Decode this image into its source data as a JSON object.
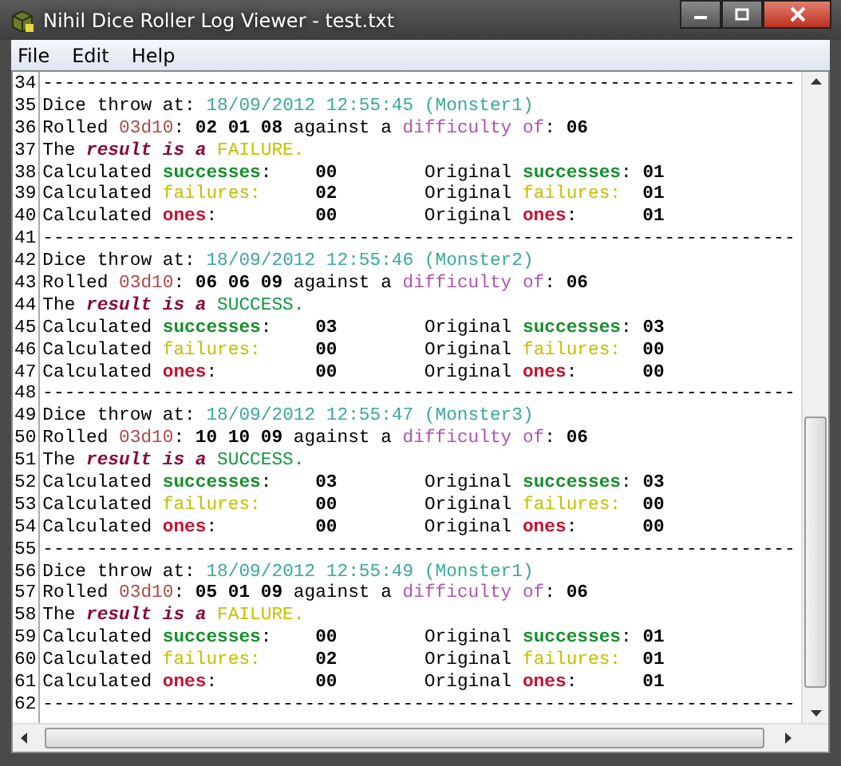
{
  "window": {
    "title": "Nihil Dice Roller Log Viewer - test.txt"
  },
  "menu": [
    {
      "label": "File"
    },
    {
      "label": "Edit"
    },
    {
      "label": "Help"
    }
  ],
  "lines": [
    {
      "number": "34",
      "segments": [
        {
          "kind": "plain",
          "text": "---------------------------------------------------------------------"
        }
      ]
    },
    {
      "number": "35",
      "segments": [
        {
          "kind": "plain",
          "text": "Dice throw at: "
        },
        {
          "kind": "date",
          "text": "18/09/2012 12:55:45 (Monster1)"
        }
      ]
    },
    {
      "number": "36",
      "segments": [
        {
          "kind": "plain",
          "text": "Rolled "
        },
        {
          "kind": "dice",
          "text": "03d10"
        },
        {
          "kind": "plain",
          "text": ": "
        },
        {
          "kind": "value",
          "text": "02 01 08"
        },
        {
          "kind": "plain",
          "text": " against a "
        },
        {
          "kind": "difficulty",
          "text": "difficulty of"
        },
        {
          "kind": "plain",
          "text": ": "
        },
        {
          "kind": "value",
          "text": "06"
        }
      ]
    },
    {
      "number": "37",
      "segments": [
        {
          "kind": "plain",
          "text": "The "
        },
        {
          "kind": "emphasis",
          "text": "result is a "
        },
        {
          "kind": "failure_result",
          "text": "FAILURE."
        }
      ]
    },
    {
      "number": "38",
      "segments": [
        {
          "kind": "plain",
          "text": "Calculated "
        },
        {
          "kind": "successes",
          "text": "successes"
        },
        {
          "kind": "plain",
          "text": ":    "
        },
        {
          "kind": "value",
          "text": "00"
        },
        {
          "kind": "plain",
          "text": "        Original "
        },
        {
          "kind": "successes",
          "text": "successes"
        },
        {
          "kind": "plain",
          "text": ": "
        },
        {
          "kind": "value",
          "text": "01"
        }
      ]
    },
    {
      "number": "39",
      "segments": [
        {
          "kind": "plain",
          "text": "Calculated "
        },
        {
          "kind": "failures",
          "text": "failures:"
        },
        {
          "kind": "value",
          "text": "     02"
        },
        {
          "kind": "plain",
          "text": "        Original "
        },
        {
          "kind": "failures",
          "text": "failures:"
        },
        {
          "kind": "value",
          "text": "  01"
        }
      ]
    },
    {
      "number": "40",
      "segments": [
        {
          "kind": "plain",
          "text": "Calculated "
        },
        {
          "kind": "ones",
          "text": "ones"
        },
        {
          "kind": "plain",
          "text": ":         "
        },
        {
          "kind": "value",
          "text": "00"
        },
        {
          "kind": "plain",
          "text": "        Original "
        },
        {
          "kind": "ones",
          "text": "ones"
        },
        {
          "kind": "plain",
          "text": ":      "
        },
        {
          "kind": "value",
          "text": "01"
        }
      ]
    },
    {
      "number": "41",
      "segments": [
        {
          "kind": "plain",
          "text": "---------------------------------------------------------------------"
        }
      ]
    },
    {
      "number": "42",
      "segments": [
        {
          "kind": "plain",
          "text": "Dice throw at: "
        },
        {
          "kind": "date",
          "text": "18/09/2012 12:55:46 (Monster2)"
        }
      ]
    },
    {
      "number": "43",
      "segments": [
        {
          "kind": "plain",
          "text": "Rolled "
        },
        {
          "kind": "dice",
          "text": "03d10"
        },
        {
          "kind": "plain",
          "text": ": "
        },
        {
          "kind": "value",
          "text": "06 06 09"
        },
        {
          "kind": "plain",
          "text": " against a "
        },
        {
          "kind": "difficulty",
          "text": "difficulty of"
        },
        {
          "kind": "plain",
          "text": ": "
        },
        {
          "kind": "value",
          "text": "06"
        }
      ]
    },
    {
      "number": "44",
      "segments": [
        {
          "kind": "plain",
          "text": "The "
        },
        {
          "kind": "emphasis",
          "text": "result is a "
        },
        {
          "kind": "success_result",
          "text": "SUCCESS."
        }
      ]
    },
    {
      "number": "45",
      "segments": [
        {
          "kind": "plain",
          "text": "Calculated "
        },
        {
          "kind": "successes",
          "text": "successes"
        },
        {
          "kind": "plain",
          "text": ":    "
        },
        {
          "kind": "value",
          "text": "03"
        },
        {
          "kind": "plain",
          "text": "        Original "
        },
        {
          "kind": "successes",
          "text": "successes"
        },
        {
          "kind": "plain",
          "text": ": "
        },
        {
          "kind": "value",
          "text": "03"
        }
      ]
    },
    {
      "number": "46",
      "segments": [
        {
          "kind": "plain",
          "text": "Calculated "
        },
        {
          "kind": "failures",
          "text": "failures:"
        },
        {
          "kind": "value",
          "text": "     00"
        },
        {
          "kind": "plain",
          "text": "        Original "
        },
        {
          "kind": "failures",
          "text": "failures:"
        },
        {
          "kind": "value",
          "text": "  00"
        }
      ]
    },
    {
      "number": "47",
      "segments": [
        {
          "kind": "plain",
          "text": "Calculated "
        },
        {
          "kind": "ones",
          "text": "ones"
        },
        {
          "kind": "plain",
          "text": ":         "
        },
        {
          "kind": "value",
          "text": "00"
        },
        {
          "kind": "plain",
          "text": "        Original "
        },
        {
          "kind": "ones",
          "text": "ones"
        },
        {
          "kind": "plain",
          "text": ":      "
        },
        {
          "kind": "value",
          "text": "00"
        }
      ]
    },
    {
      "number": "48",
      "segments": [
        {
          "kind": "plain",
          "text": "---------------------------------------------------------------------"
        }
      ]
    },
    {
      "number": "49",
      "segments": [
        {
          "kind": "plain",
          "text": "Dice throw at: "
        },
        {
          "kind": "date",
          "text": "18/09/2012 12:55:47 (Monster3)"
        }
      ]
    },
    {
      "number": "50",
      "segments": [
        {
          "kind": "plain",
          "text": "Rolled "
        },
        {
          "kind": "dice",
          "text": "03d10"
        },
        {
          "kind": "plain",
          "text": ": "
        },
        {
          "kind": "value",
          "text": "10 10 09"
        },
        {
          "kind": "plain",
          "text": " against a "
        },
        {
          "kind": "difficulty",
          "text": "difficulty of"
        },
        {
          "kind": "plain",
          "text": ": "
        },
        {
          "kind": "value",
          "text": "06"
        }
      ]
    },
    {
      "number": "51",
      "segments": [
        {
          "kind": "plain",
          "text": "The "
        },
        {
          "kind": "emphasis",
          "text": "result is a "
        },
        {
          "kind": "success_result",
          "text": "SUCCESS."
        }
      ]
    },
    {
      "number": "52",
      "segments": [
        {
          "kind": "plain",
          "text": "Calculated "
        },
        {
          "kind": "successes",
          "text": "successes"
        },
        {
          "kind": "plain",
          "text": ":    "
        },
        {
          "kind": "value",
          "text": "03"
        },
        {
          "kind": "plain",
          "text": "        Original "
        },
        {
          "kind": "successes",
          "text": "successes"
        },
        {
          "kind": "plain",
          "text": ": "
        },
        {
          "kind": "value",
          "text": "03"
        }
      ]
    },
    {
      "number": "53",
      "segments": [
        {
          "kind": "plain",
          "text": "Calculated "
        },
        {
          "kind": "failures",
          "text": "failures:"
        },
        {
          "kind": "value",
          "text": "     00"
        },
        {
          "kind": "plain",
          "text": "        Original "
        },
        {
          "kind": "failures",
          "text": "failures:"
        },
        {
          "kind": "value",
          "text": "  00"
        }
      ]
    },
    {
      "number": "54",
      "segments": [
        {
          "kind": "plain",
          "text": "Calculated "
        },
        {
          "kind": "ones",
          "text": "ones"
        },
        {
          "kind": "plain",
          "text": ":         "
        },
        {
          "kind": "value",
          "text": "00"
        },
        {
          "kind": "plain",
          "text": "        Original "
        },
        {
          "kind": "ones",
          "text": "ones"
        },
        {
          "kind": "plain",
          "text": ":      "
        },
        {
          "kind": "value",
          "text": "00"
        }
      ]
    },
    {
      "number": "55",
      "segments": [
        {
          "kind": "plain",
          "text": "---------------------------------------------------------------------"
        }
      ]
    },
    {
      "number": "56",
      "segments": [
        {
          "kind": "plain",
          "text": "Dice throw at: "
        },
        {
          "kind": "date",
          "text": "18/09/2012 12:55:49 (Monster1)"
        }
      ]
    },
    {
      "number": "57",
      "segments": [
        {
          "kind": "plain",
          "text": "Rolled "
        },
        {
          "kind": "dice",
          "text": "03d10"
        },
        {
          "kind": "plain",
          "text": ": "
        },
        {
          "kind": "value",
          "text": "05 01 09"
        },
        {
          "kind": "plain",
          "text": " against a "
        },
        {
          "kind": "difficulty",
          "text": "difficulty of"
        },
        {
          "kind": "plain",
          "text": ": "
        },
        {
          "kind": "value",
          "text": "06"
        }
      ]
    },
    {
      "number": "58",
      "segments": [
        {
          "kind": "plain",
          "text": "The "
        },
        {
          "kind": "emphasis",
          "text": "result is a "
        },
        {
          "kind": "failure_result",
          "text": "FAILURE."
        }
      ]
    },
    {
      "number": "59",
      "segments": [
        {
          "kind": "plain",
          "text": "Calculated "
        },
        {
          "kind": "successes",
          "text": "successes"
        },
        {
          "kind": "plain",
          "text": ":    "
        },
        {
          "kind": "value",
          "text": "00"
        },
        {
          "kind": "plain",
          "text": "        Original "
        },
        {
          "kind": "successes",
          "text": "successes"
        },
        {
          "kind": "plain",
          "text": ": "
        },
        {
          "kind": "value",
          "text": "01"
        }
      ]
    },
    {
      "number": "60",
      "segments": [
        {
          "kind": "plain",
          "text": "Calculated "
        },
        {
          "kind": "failures",
          "text": "failures:"
        },
        {
          "kind": "value",
          "text": "     02"
        },
        {
          "kind": "plain",
          "text": "        Original "
        },
        {
          "kind": "failures",
          "text": "failures:"
        },
        {
          "kind": "value",
          "text": "  01"
        }
      ]
    },
    {
      "number": "61",
      "segments": [
        {
          "kind": "plain",
          "text": "Calculated "
        },
        {
          "kind": "ones",
          "text": "ones"
        },
        {
          "kind": "plain",
          "text": ":         "
        },
        {
          "kind": "value",
          "text": "00"
        },
        {
          "kind": "plain",
          "text": "        Original "
        },
        {
          "kind": "ones",
          "text": "ones"
        },
        {
          "kind": "plain",
          "text": ":      "
        },
        {
          "kind": "value",
          "text": "01"
        }
      ]
    },
    {
      "number": "62",
      "segments": [
        {
          "kind": "plain",
          "text": "---------------------------------------------------------------------"
        }
      ]
    }
  ]
}
